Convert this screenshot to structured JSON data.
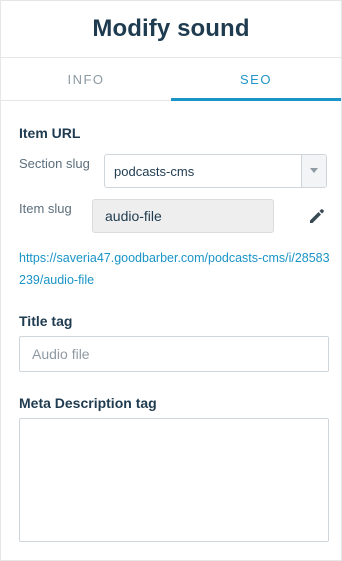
{
  "header": {
    "title": "Modify sound"
  },
  "tabs": [
    {
      "label": "INFO",
      "active": false
    },
    {
      "label": "SEO",
      "active": true
    }
  ],
  "item_url": {
    "title": "Item URL",
    "section_slug_label": "Section slug",
    "section_slug_value": "podcasts-cms",
    "item_slug_label": "Item slug",
    "item_slug_value": "audio-file",
    "url": "https://saveria47.goodbarber.com/podcasts-cms/i/28583239/audio-file"
  },
  "title_tag": {
    "label": "Title tag",
    "placeholder": "Audio file",
    "value": ""
  },
  "meta_description": {
    "label": "Meta Description tag",
    "value": ""
  },
  "colors": {
    "accent": "#1a94c6",
    "title_text": "#1f3b4f",
    "muted_text": "#8c9aa3"
  },
  "icons": {
    "select_arrow": "caret-down-icon",
    "edit": "pencil-icon"
  }
}
